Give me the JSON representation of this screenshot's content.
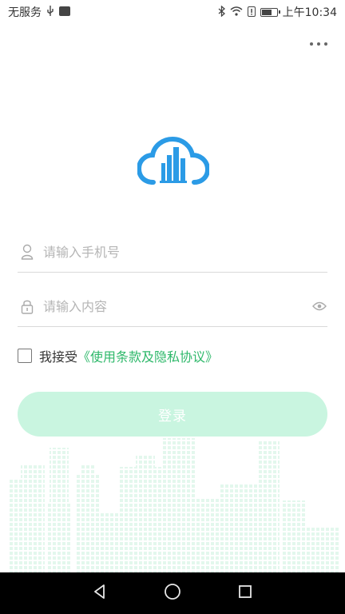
{
  "status_bar": {
    "carrier": "无服务",
    "time": "上午10:34",
    "icons": [
      "usb-icon",
      "notification-icon",
      "bluetooth-icon",
      "wifi-icon",
      "alert-icon",
      "battery-icon"
    ],
    "battery_level": 0.6
  },
  "header": {
    "more_icon": "more-dots-icon"
  },
  "form": {
    "phone_placeholder": "请输入手机号",
    "password_placeholder": "请输入内容",
    "agree_prefix": "我接受",
    "terms_link": "《使用条款及隐私协议》",
    "login_label": "登录"
  },
  "colors": {
    "brand_blue": "#2b9be6",
    "accent_green": "#2eb86a",
    "login_button_bg": "#c9f5e0",
    "city_tint": "#e3f7ed"
  },
  "nav": {
    "back": "back-icon",
    "home": "home-icon",
    "recents": "recents-icon"
  }
}
